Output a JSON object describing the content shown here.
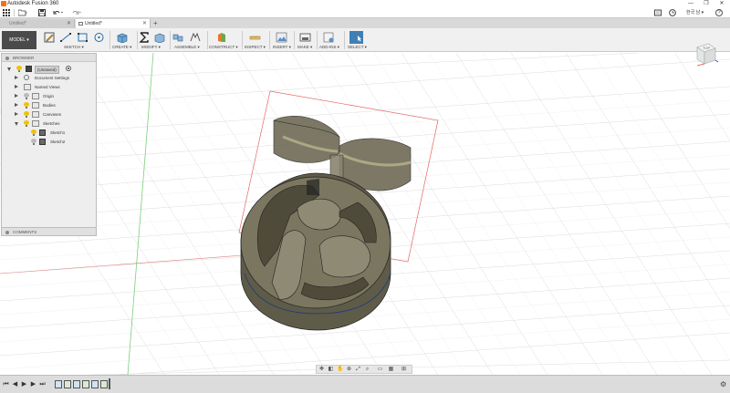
{
  "window": {
    "title": "Autodesk Fusion 360",
    "minimize": "—",
    "restore": "❐",
    "close": "✕"
  },
  "quickaccess": {
    "language": "한국 남 ▾",
    "help": "?"
  },
  "tabs": [
    {
      "label": "Untitled*",
      "active": false
    },
    {
      "label": "Untitled*",
      "active": true
    }
  ],
  "toolbar": {
    "workspace": "MODEL ▾",
    "groups": [
      {
        "label": "SKETCH ▾"
      },
      {
        "label": "CREATE ▾"
      },
      {
        "label": "MODIFY ▾"
      },
      {
        "label": "ASSEMBLE ▾"
      },
      {
        "label": "CONSTRUCT ▾"
      },
      {
        "label": "INSPECT ▾"
      },
      {
        "label": "INSERT ▾"
      },
      {
        "label": "MAKE ▾"
      },
      {
        "label": "ADD-INS ▾"
      },
      {
        "label": "SELECT ▾"
      }
    ]
  },
  "browser": {
    "header": "BROWSER",
    "root": "(Unsaved)",
    "items": [
      {
        "label": "Document Settings"
      },
      {
        "label": "Named Views"
      },
      {
        "label": "Origin"
      },
      {
        "label": "Bodies"
      },
      {
        "label": "Canvases"
      },
      {
        "label": "Sketches"
      },
      {
        "label": "Sketch1"
      },
      {
        "label": "Sketch2"
      }
    ]
  },
  "comments": {
    "header": "COMMENTS"
  },
  "viewcube": {
    "face": "TOP"
  },
  "colors": {
    "accent": "#f37021",
    "selection": "#1b6fb5",
    "model": "#6e6a55",
    "sketch_profile": "#e04040"
  }
}
